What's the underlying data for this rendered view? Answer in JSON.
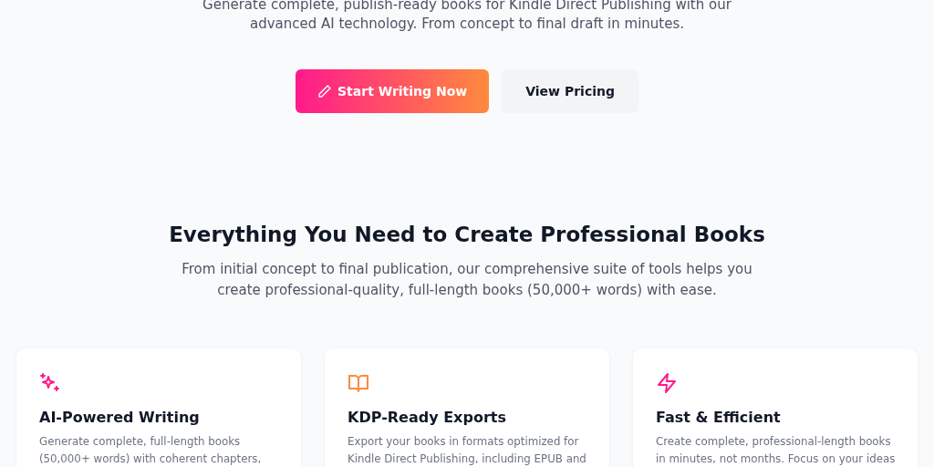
{
  "hero": {
    "description_lines": [
      "Generate complete, publish-ready books for Kindle Direct Publishing with our",
      "advanced AI technology. From concept to final draft in minutes."
    ],
    "buttons": [
      {
        "label": "Start Writing Now",
        "kind": "primary"
      },
      {
        "label": "View Pricing",
        "kind": "secondary"
      }
    ]
  },
  "features": {
    "title": "Everything You Need to Create Professional Books",
    "subtitle_lines": [
      "From initial concept to final publication, our comprehensive suite of tools helps you",
      "create professional-quality, full-length books (50,000+ words) with ease."
    ],
    "cards": [
      {
        "kind": "sparkles",
        "color": "#ff1a8c",
        "title": "AI-Powered Writing",
        "description_lines": [
          "Generate complete, full-length books",
          "(50,000+ words) with coherent chapters,"
        ]
      },
      {
        "kind": "book",
        "color": "#ff8a3d",
        "title": "KDP-Ready Exports",
        "description_lines": [
          "Export your books in formats optimized for",
          "Kindle Direct Publishing, including EPUB and"
        ]
      },
      {
        "kind": "bolt",
        "color": "#ff1a8c",
        "title": "Fast & Efficient",
        "description_lines": [
          "Create complete, professional-length books",
          "in minutes, not months. Focus on your ideas"
        ]
      }
    ]
  }
}
